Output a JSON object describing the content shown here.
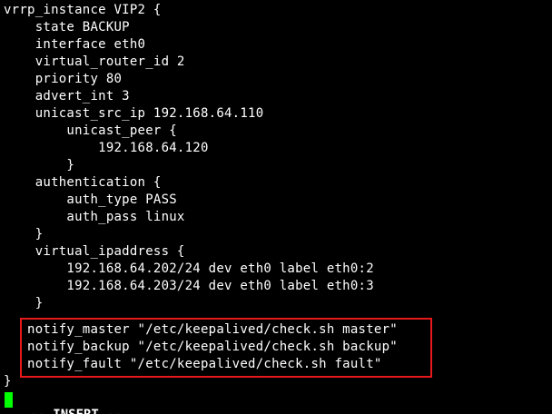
{
  "editor": {
    "lines": [
      "vrrp_instance VIP2 {",
      "    state BACKUP",
      "    interface eth0",
      "    virtual_router_id 2",
      "    priority 80",
      "    advert_int 3",
      "    unicast_src_ip 192.168.64.110",
      "        unicast_peer {",
      "            192.168.64.120",
      "        }",
      "    authentication {",
      "        auth_type PASS",
      "        auth_pass linux",
      "    }",
      "    virtual_ipaddress {",
      "        192.168.64.202/24 dev eth0 label eth0:2",
      "        192.168.64.203/24 dev eth0 label eth0:3",
      "    }",
      "   notify_master \"/etc/keepalived/check.sh master\"",
      "   notify_backup \"/etc/keepalived/check.sh backup\"",
      "   notify_fault \"/etc/keepalived/check.sh fault\"",
      "}"
    ],
    "highlight_color": "#e8191b",
    "cursor_color": "#00ff00",
    "mode_label": "-- INSERT --"
  }
}
